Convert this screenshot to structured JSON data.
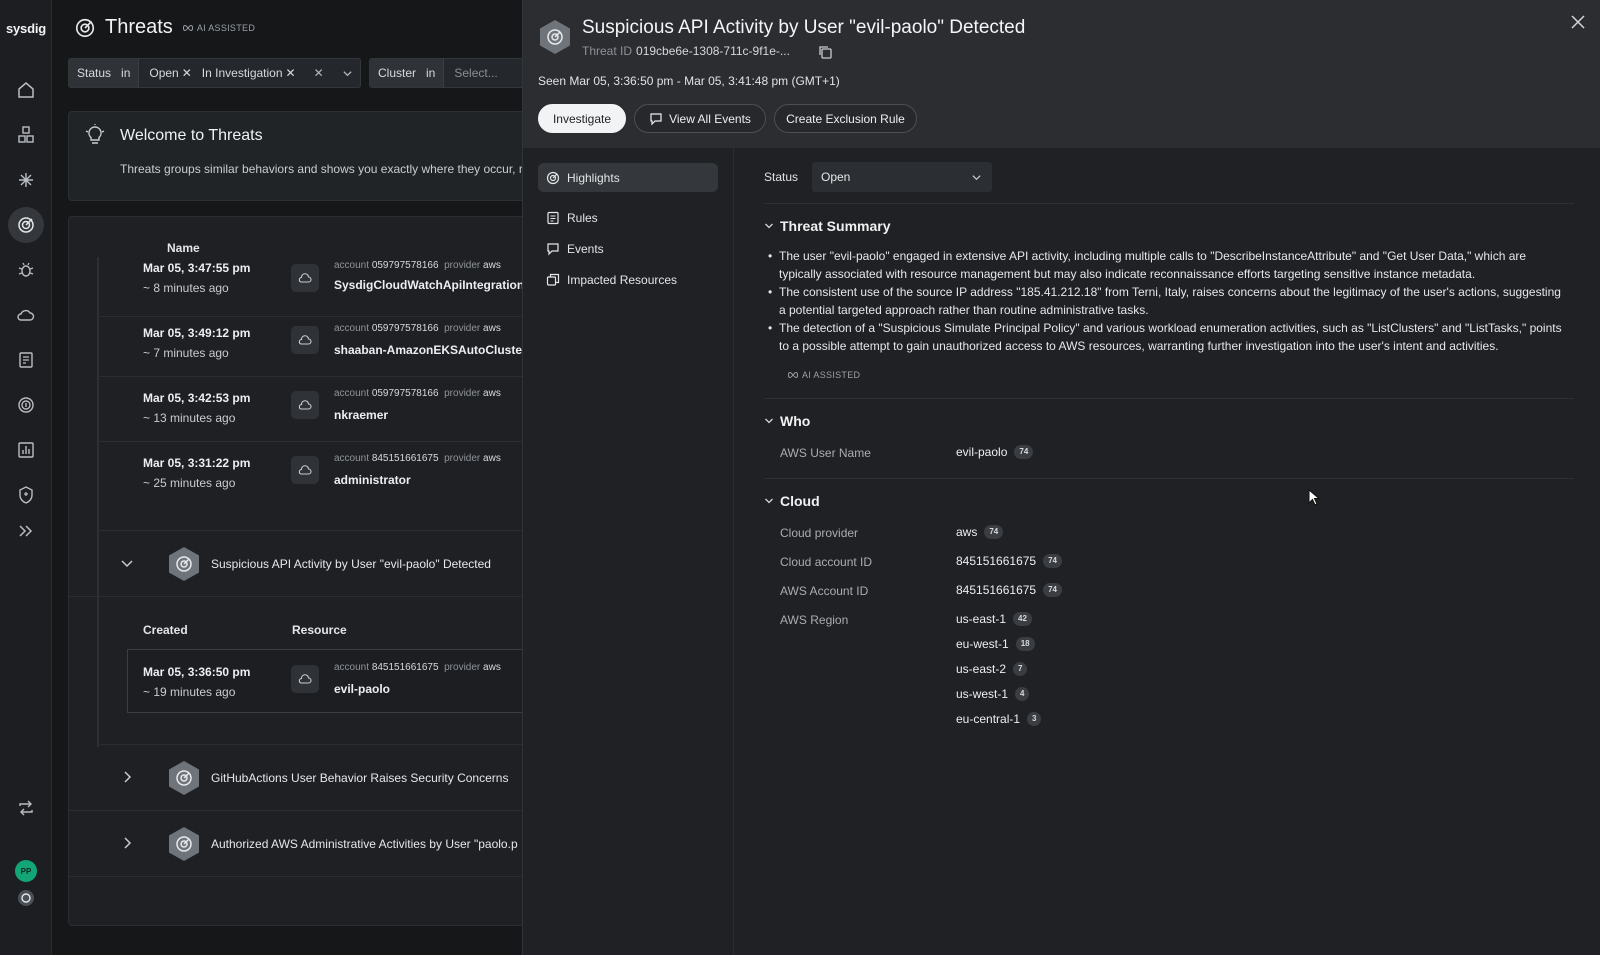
{
  "brand": "sysdig",
  "page": {
    "title": "Threats",
    "ai_tag": "AI ASSISTED",
    "filters": [
      {
        "key": "Status",
        "op": "in",
        "chips": [
          "Open",
          "In Investigation"
        ]
      },
      {
        "key": "Cluster",
        "op": "in",
        "placeholder": "Select..."
      }
    ],
    "welcome": {
      "title": "Welcome to Threats",
      "text": "Threats groups similar behaviors and shows you exactly where they occur, re"
    },
    "list": {
      "name_header": "Name",
      "created_header": "Created",
      "resource_header": "Resource",
      "events": [
        {
          "date": "Mar 05, 3:47:55 pm",
          "ago": "~ 8 minutes ago",
          "account_label": "account",
          "account": "059797578166",
          "provider_label": "provider",
          "provider": "aws",
          "resource": "SysdigCloudWatchApiIntegration"
        },
        {
          "date": "Mar 05, 3:49:12 pm",
          "ago": "~ 7 minutes ago",
          "account_label": "account",
          "account": "059797578166",
          "provider_label": "provider",
          "provider": "aws",
          "resource": "shaaban-AmazonEKSAutoCluster"
        },
        {
          "date": "Mar 05, 3:42:53 pm",
          "ago": "~ 13 minutes ago",
          "account_label": "account",
          "account": "059797578166",
          "provider_label": "provider",
          "provider": "aws",
          "resource": "nkraemer"
        },
        {
          "date": "Mar 05, 3:31:22 pm",
          "ago": "~ 25 minutes ago",
          "account_label": "account",
          "account": "845151661675",
          "provider_label": "provider",
          "provider": "aws",
          "resource": "administrator"
        }
      ],
      "groups": [
        {
          "name": "Suspicious API Activity by User \"evil-paolo\" Detected"
        },
        {
          "name": "GitHubActions User Behavior Raises Security Concerns"
        },
        {
          "name": "Authorized AWS Administrative Activities by User \"paolo.p"
        }
      ],
      "expanded_event": {
        "date": "Mar 05, 3:36:50 pm",
        "ago": "~ 19 minutes ago",
        "account_label": "account",
        "account": "845151661675",
        "provider_label": "provider",
        "provider": "aws",
        "resource": "evil-paolo"
      }
    }
  },
  "user": {
    "initials": "PP"
  },
  "drawer": {
    "title": "Suspicious API Activity by User \"evil-paolo\" Detected",
    "threat_id_label": "Threat ID",
    "threat_id": "019cbe6e-1308-711c-9f1e-...",
    "seen": "Seen Mar 05, 3:36:50 pm - Mar 05, 3:41:48 pm (GMT+1)",
    "buttons": {
      "investigate": "Investigate",
      "view_events": "View All Events",
      "exclusion": "Create Exclusion Rule"
    },
    "nav": [
      "Highlights",
      "Rules",
      "Events",
      "Impacted Resources"
    ],
    "status_label": "Status",
    "status_value": "Open",
    "summary": {
      "title": "Threat Summary",
      "bullets": [
        "The user \"evil-paolo\" engaged in extensive API activity, including multiple calls to \"DescribeInstanceAttribute\" and \"Get User Data,\" which are typically associated with resource management but may also indicate reconnaissance efforts targeting sensitive instance metadata.",
        "The consistent use of the source IP address \"185.41.212.18\" from Terni, Italy, raises concerns about the legitimacy of the user's actions, suggesting a potential targeted approach rather than routine administrative tasks.",
        "The detection of a \"Suspicious Simulate Principal Policy\" and various workload enumeration activities, such as \"ListClusters\" and \"ListTasks,\" points to a possible attempt to gain unauthorized access to AWS resources, warranting further investigation into the user's intent and activities."
      ],
      "ai_tag": "AI ASSISTED"
    },
    "who": {
      "title": "Who",
      "rows": [
        {
          "key": "AWS User Name",
          "value": "evil-paolo",
          "count": "74"
        }
      ]
    },
    "cloud": {
      "title": "Cloud",
      "rows": [
        {
          "key": "Cloud provider",
          "value": "aws",
          "count": "74"
        },
        {
          "key": "Cloud account ID",
          "value": "845151661675",
          "count": "74"
        },
        {
          "key": "AWS Account ID",
          "value": "845151661675",
          "count": "74"
        }
      ],
      "region_key": "AWS Region",
      "regions": [
        {
          "value": "us-east-1",
          "count": "42"
        },
        {
          "value": "eu-west-1",
          "count": "18"
        },
        {
          "value": "us-east-2",
          "count": "7"
        },
        {
          "value": "us-west-1",
          "count": "4"
        },
        {
          "value": "eu-central-1",
          "count": "3"
        }
      ]
    }
  },
  "colors": {
    "bg": "#151719",
    "drawer": "#1f2124",
    "drawer_head": "#2b2d31",
    "accent_green": "#13a575"
  }
}
